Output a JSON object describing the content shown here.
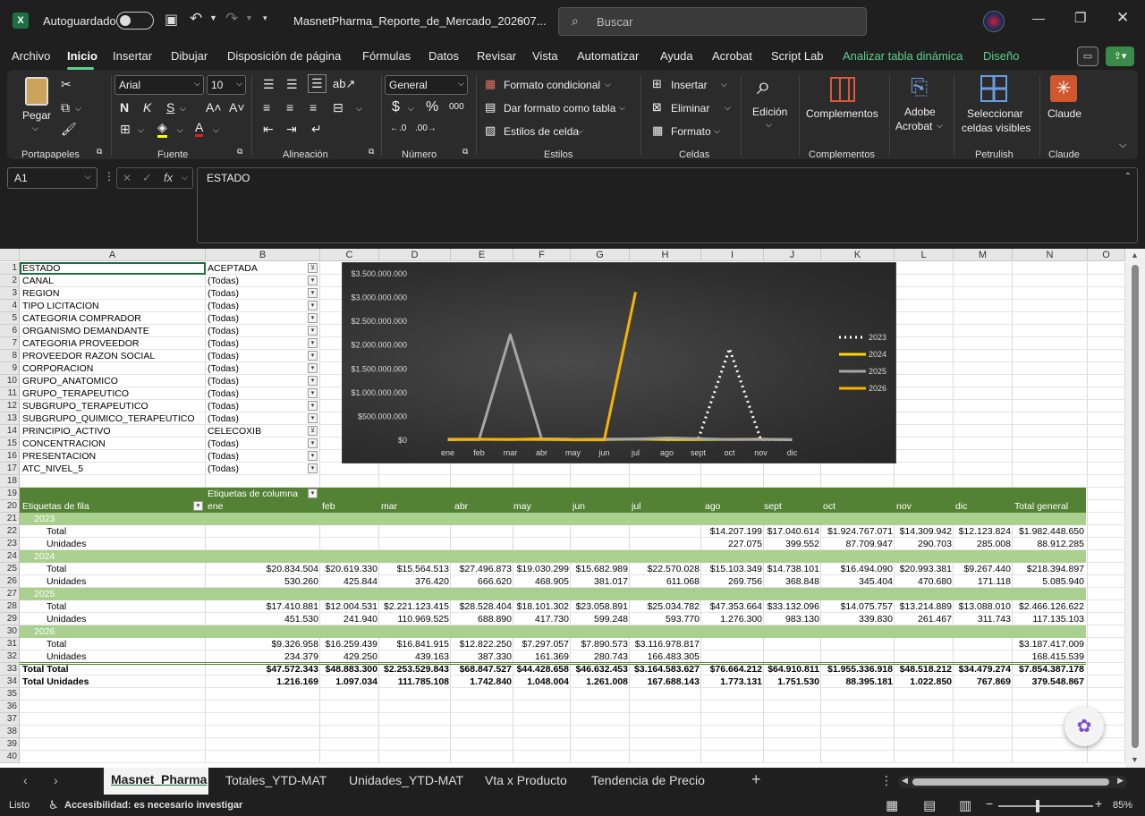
{
  "app": {
    "autosave_label": "Autoguardado",
    "file_name": "MasnetPharma_Reporte_de_Mercado_202607...",
    "search_placeholder": "Buscar"
  },
  "menu": {
    "items": [
      "Archivo",
      "Inicio",
      "Insertar",
      "Dibujar",
      "Disposición de página",
      "Fórmulas",
      "Datos",
      "Revisar",
      "Vista",
      "Automatizar",
      "Ayuda",
      "Acrobat",
      "Script Lab",
      "Analizar tabla dinámica",
      "Diseño"
    ],
    "active": "Inicio"
  },
  "ribbon": {
    "paste_label": "Pegar",
    "font_name": "Arial",
    "font_size": "10",
    "number_format": "General",
    "cond_format": "Formato condicional",
    "table_format": "Dar formato como tabla",
    "cell_styles": "Estilos de celda",
    "insert": "Insertar",
    "delete": "Eliminar",
    "format": "Formato",
    "edit": "Edición",
    "addins": "Complementos",
    "adobe": "Adobe",
    "acrobat": "Acrobat",
    "select_visible": "Seleccionar",
    "select_visible2": "celdas visibles",
    "claude": "Claude",
    "groups": {
      "clipboard": "Portapapeles",
      "font": "Fuente",
      "alignment": "Alineación",
      "number": "Número",
      "styles": "Estilos",
      "cells": "Celdas",
      "addins": "Complementos",
      "petrulish": "Petrulish",
      "claude": "Claude"
    }
  },
  "formula_bar": {
    "name_box": "A1",
    "content": "ESTADO"
  },
  "columns": [
    "A",
    "B",
    "C",
    "D",
    "E",
    "F",
    "G",
    "H",
    "I",
    "J",
    "K",
    "L",
    "M",
    "N",
    "O"
  ],
  "filters": [
    {
      "field": "ESTADO",
      "value": "ACEPTADA",
      "filtered": true
    },
    {
      "field": "CANAL",
      "value": "(Todas)",
      "filtered": false
    },
    {
      "field": "REGION",
      "value": "(Todas)",
      "filtered": false
    },
    {
      "field": "TIPO LICITACION",
      "value": "(Todas)",
      "filtered": false
    },
    {
      "field": "CATEGORIA COMPRADOR",
      "value": "(Todas)",
      "filtered": false
    },
    {
      "field": "ORGANISMO DEMANDANTE",
      "value": "(Todas)",
      "filtered": false
    },
    {
      "field": "CATEGORIA PROVEEDOR",
      "value": "(Todas)",
      "filtered": false
    },
    {
      "field": "PROVEEDOR RAZON SOCIAL",
      "value": "(Todas)",
      "filtered": false
    },
    {
      "field": "CORPORACION",
      "value": "(Todas)",
      "filtered": false
    },
    {
      "field": "GRUPO_ANATOMICO",
      "value": "(Todas)",
      "filtered": false
    },
    {
      "field": "GRUPO_TERAPEUTICO",
      "value": "(Todas)",
      "filtered": false
    },
    {
      "field": "SUBGRUPO_TERAPEUTICO",
      "value": "(Todas)",
      "filtered": false
    },
    {
      "field": "SUBGRUPO_QUIMICO_TERAPEUTICO",
      "value": "(Todas)",
      "filtered": false
    },
    {
      "field": "PRINCIPIO_ACTIVO",
      "value": "CELECOXIB",
      "filtered": true
    },
    {
      "field": "CONCENTRACION",
      "value": "(Todas)",
      "filtered": false
    },
    {
      "field": "PRESENTACION",
      "value": "(Todas)",
      "filtered": false
    },
    {
      "field": "ATC_NIVEL_5",
      "value": "(Todas)",
      "filtered": false
    }
  ],
  "pivot": {
    "col_labels_caption": "Etiquetas de columna",
    "row_labels_caption": "Etiquetas de fila",
    "headers": [
      "ene",
      "feb",
      "mar",
      "abr",
      "may",
      "jun",
      "jul",
      "ago",
      "sept",
      "oct",
      "nov",
      "dic",
      "Total general"
    ],
    "rows": [
      {
        "label": "2023",
        "type": "year"
      },
      {
        "label": "Total",
        "type": "val",
        "cells": [
          "",
          "",
          "",
          "",
          "",
          "",
          "",
          "$14.207.199",
          "$17.040.614",
          "$1.924.767.071",
          "$14.309.942",
          "$12.123.824",
          "$1.982.448.650"
        ]
      },
      {
        "label": "Unidades",
        "type": "val",
        "cells": [
          "",
          "",
          "",
          "",
          "",
          "",
          "",
          "227.075",
          "399.552",
          "87.709.947",
          "290.703",
          "285.008",
          "88.912.285"
        ]
      },
      {
        "label": "2024",
        "type": "year"
      },
      {
        "label": "Total",
        "type": "val",
        "cells": [
          "$20.834.504",
          "$20.619.330",
          "$15.564.513",
          "$27.496.873",
          "$19.030.299",
          "$15.682.989",
          "$22.570.028",
          "$15.103.349",
          "$14.738.101",
          "$16.494.090",
          "$20.993.381",
          "$9.267.440",
          "$218.394.897"
        ]
      },
      {
        "label": "Unidades",
        "type": "val",
        "cells": [
          "530.260",
          "425.844",
          "376.420",
          "666.620",
          "468.905",
          "381.017",
          "611.068",
          "269.756",
          "368.848",
          "345.404",
          "470.680",
          "171.118",
          "5.085.940"
        ]
      },
      {
        "label": "2025",
        "type": "year"
      },
      {
        "label": "Total",
        "type": "val",
        "cells": [
          "$17.410.881",
          "$12.004.531",
          "$2.221.123.415",
          "$28.528.404",
          "$18.101.302",
          "$23.058.891",
          "$25.034.782",
          "$47.353.664",
          "$33.132.096",
          "$14.075.757",
          "$13.214.889",
          "$13.088.010",
          "$2.466.126.622"
        ]
      },
      {
        "label": "Unidades",
        "type": "val",
        "cells": [
          "451.530",
          "241.940",
          "110.969.525",
          "688.890",
          "417.730",
          "599.248",
          "593.770",
          "1.276.300",
          "983.130",
          "339.830",
          "261.467",
          "311.743",
          "117.135.103"
        ]
      },
      {
        "label": "2026",
        "type": "year"
      },
      {
        "label": "Total",
        "type": "val",
        "cells": [
          "$9.326.958",
          "$16.259.439",
          "$16.841.915",
          "$12.822.250",
          "$7.297.057",
          "$7.890.573",
          "$3.116.978.817",
          "",
          "",
          "",
          "",
          "",
          "$3.187.417.009"
        ]
      },
      {
        "label": "Unidades",
        "type": "val",
        "cells": [
          "234.379",
          "429.250",
          "439.163",
          "387.330",
          "161.369",
          "280.743",
          "166.483.305",
          "",
          "",
          "",
          "",
          "",
          "168.415.539"
        ]
      },
      {
        "label": "Total Total",
        "type": "grand",
        "cells": [
          "$47.572.343",
          "$48.883.300",
          "$2.253.529.843",
          "$68.847.527",
          "$44.428.658",
          "$46.632.453",
          "$3.164.583.627",
          "$76.664.212",
          "$64.910.811",
          "$1.955.336.918",
          "$48.518.212",
          "$34.479.274",
          "$7.854.387.178"
        ]
      },
      {
        "label": "Total Unidades",
        "type": "grand",
        "cells": [
          "1.216.169",
          "1.097.034",
          "111.785.108",
          "1.742.840",
          "1.048.004",
          "1.261.008",
          "167.688.143",
          "1.773.131",
          "1.751.530",
          "88.395.181",
          "1.022.850",
          "767.869",
          "379.548.867"
        ]
      }
    ]
  },
  "chart_data": {
    "type": "line",
    "categories": [
      "ene",
      "feb",
      "mar",
      "abr",
      "may",
      "jun",
      "jul",
      "ago",
      "sept",
      "oct",
      "nov",
      "dic"
    ],
    "ylim": [
      0,
      3500000000
    ],
    "yticks": [
      "$0",
      "$500.000.000",
      "$1.000.000.000",
      "$1.500.000.000",
      "$2.000.000.000",
      "$2.500.000.000",
      "$3.000.000.000",
      "$3.500.000.000"
    ],
    "legend_position": "right",
    "background": "dark",
    "series": [
      {
        "name": "2023",
        "color": "#ffffff",
        "dash": true,
        "values": [
          null,
          null,
          null,
          null,
          null,
          null,
          null,
          14207199,
          17040614,
          1924767071,
          14309942,
          12123824
        ]
      },
      {
        "name": "2024",
        "color": "#ffd700",
        "dash": false,
        "values": [
          20834504,
          20619330,
          15564513,
          27496873,
          19030299,
          15682989,
          22570028,
          15103349,
          14738101,
          16494090,
          20993381,
          9267440
        ]
      },
      {
        "name": "2025",
        "color": "#a6a6a6",
        "dash": false,
        "values": [
          17410881,
          12004531,
          2221123415,
          28528404,
          18101302,
          23058891,
          25034782,
          47353664,
          33132096,
          14075757,
          13214889,
          13088010
        ]
      },
      {
        "name": "2026",
        "color": "#f5b400",
        "dash": false,
        "values": [
          9326958,
          16259439,
          16841915,
          12822250,
          7297057,
          7890573,
          3116978817,
          null,
          null,
          null,
          null,
          null
        ]
      }
    ]
  },
  "sheets": [
    "Masnet_Pharma",
    "Totales_YTD-MAT",
    "Unidades_YTD-MAT",
    "Vta x Producto",
    "Tendencia de Precio"
  ],
  "active_sheet": "Masnet_Pharma",
  "status": {
    "ready": "Listo",
    "accessibility": "Accesibilidad: es necesario investigar",
    "zoom": "85%"
  }
}
